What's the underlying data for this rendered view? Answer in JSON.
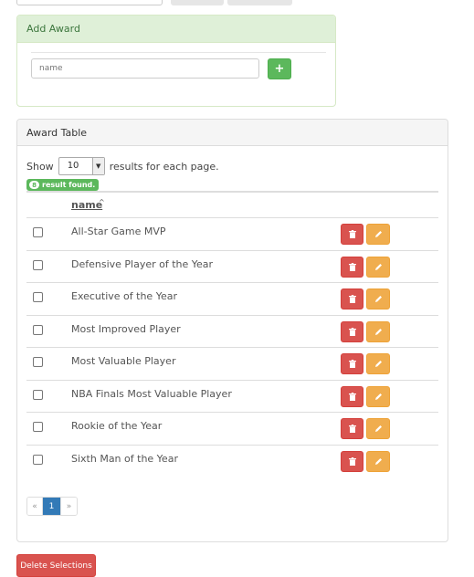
{
  "add_panel": {
    "title": "Add Award",
    "name_placeholder": "name",
    "add_icon": "plus-icon"
  },
  "table_panel": {
    "title": "Award Table",
    "show_label": "Show",
    "page_size": "10",
    "results_label": "results for each page.",
    "result_count": "8",
    "result_text": "result found.",
    "column_name": "name",
    "sort_indicator": "^",
    "rows": [
      {
        "name": "All-Star Game MVP"
      },
      {
        "name": "Defensive Player of the Year"
      },
      {
        "name": "Executive of the Year"
      },
      {
        "name": "Most Improved Player"
      },
      {
        "name": "Most Valuable Player"
      },
      {
        "name": "NBA Finals Most Valuable Player"
      },
      {
        "name": "Rookie of the Year"
      },
      {
        "name": "Sixth Man of the Year"
      }
    ],
    "pagination": {
      "prev": "«",
      "current": "1",
      "next": "»"
    }
  },
  "delete_selections_label": "Delete Selections",
  "colors": {
    "success": "#5cb85c",
    "danger": "#d9534f",
    "warning": "#f0ad4e",
    "primary": "#337ab7"
  }
}
